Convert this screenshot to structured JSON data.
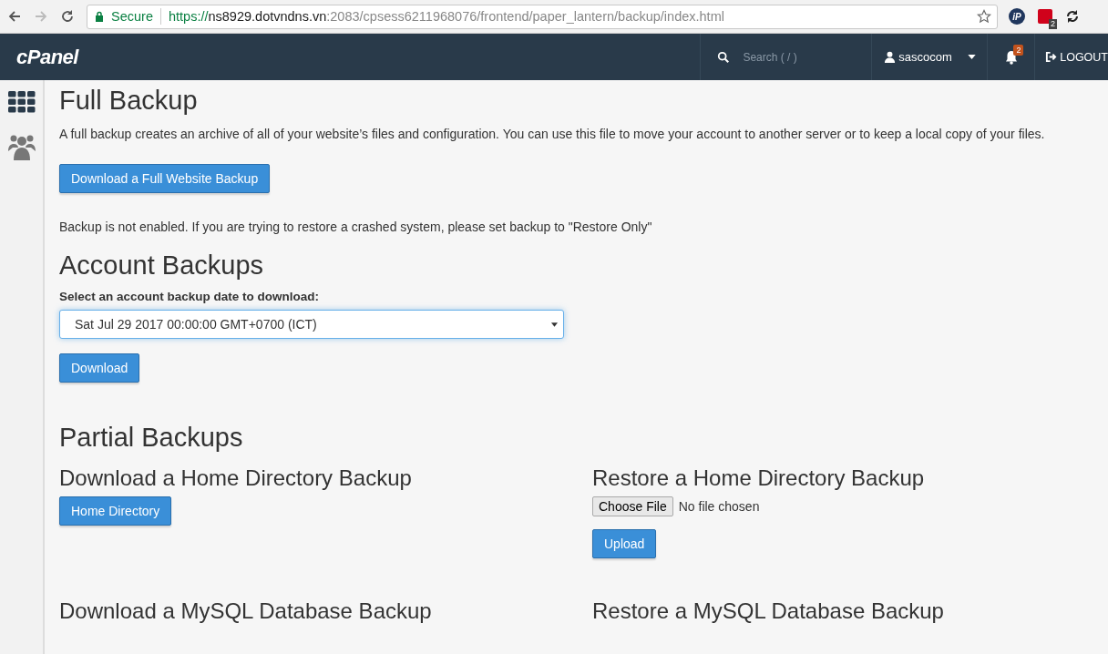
{
  "browser": {
    "url": {
      "secure_label": "Secure",
      "scheme": "https://",
      "host": "ns8929.dotvndns.vn",
      "path": ":2083/cpsess6211968076/frontend/paper_lantern/backup/index.html"
    },
    "extensions": [
      {
        "kind": "ip",
        "text": "iP"
      },
      {
        "kind": "badge",
        "badge": "2"
      },
      {
        "kind": "sync"
      }
    ]
  },
  "header": {
    "logo": "cPanel",
    "search_placeholder": "Search ( / )",
    "user": "sascocom",
    "notifications": "2",
    "logout": "LOGOUT"
  },
  "sidebar": [
    {
      "kind": "grid"
    },
    {
      "kind": "users"
    }
  ],
  "full_backup": {
    "title": "Full Backup",
    "description": "A full backup creates an archive of all of your website’s files and configuration. You can use this file to move your account to another server or to keep a local copy of your files.",
    "button": "Download a Full Website Backup",
    "notice": "Backup is not enabled. If you are trying to restore a crashed system, please set backup to \"Restore Only\""
  },
  "account_backups": {
    "title": "Account Backups",
    "label": "Select an account backup date to download:",
    "selected_date": "Sat Jul 29 2017 00:00:00 GMT+0700 (ICT)",
    "button": "Download"
  },
  "partial_backups": {
    "title": "Partial Backups",
    "sections": [
      {
        "kind": "download",
        "title": "Download a Home Directory Backup",
        "button": "Home Directory"
      },
      {
        "kind": "restore",
        "title": "Restore a Home Directory Backup",
        "choose": "Choose File",
        "no_file": "No file chosen",
        "button": "Upload"
      },
      {
        "kind": "download",
        "title": "Download a MySQL Database Backup"
      },
      {
        "kind": "restore",
        "title": "Restore a MySQL Database Backup"
      }
    ]
  }
}
